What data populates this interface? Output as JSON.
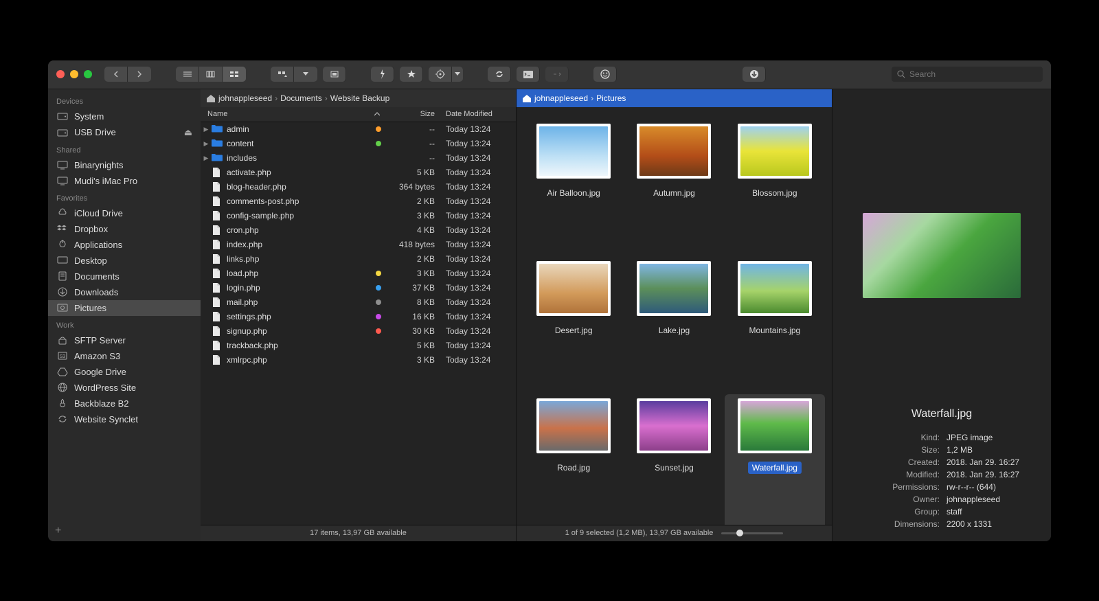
{
  "search_placeholder": "Search",
  "sidebar": {
    "sections": [
      {
        "title": "Devices",
        "items": [
          {
            "icon": "drive",
            "label": "System"
          },
          {
            "icon": "drive",
            "label": "USB Drive",
            "eject": true
          }
        ]
      },
      {
        "title": "Shared",
        "items": [
          {
            "icon": "monitor",
            "label": "Binarynights"
          },
          {
            "icon": "monitor",
            "label": "Mudi's iMac Pro"
          }
        ]
      },
      {
        "title": "Favorites",
        "items": [
          {
            "icon": "cloud",
            "label": "iCloud Drive"
          },
          {
            "icon": "dropbox",
            "label": "Dropbox"
          },
          {
            "icon": "apps",
            "label": "Applications"
          },
          {
            "icon": "desktop",
            "label": "Desktop"
          },
          {
            "icon": "doc",
            "label": "Documents"
          },
          {
            "icon": "download",
            "label": "Downloads"
          },
          {
            "icon": "pictures",
            "label": "Pictures",
            "selected": true
          }
        ]
      },
      {
        "title": "Work",
        "items": [
          {
            "icon": "lock",
            "label": "SFTP Server"
          },
          {
            "icon": "s3",
            "label": "Amazon S3"
          },
          {
            "icon": "gdrive",
            "label": "Google Drive"
          },
          {
            "icon": "globe",
            "label": "WordPress Site"
          },
          {
            "icon": "flame",
            "label": "Backblaze B2"
          },
          {
            "icon": "sync",
            "label": "Website Synclet"
          }
        ]
      }
    ]
  },
  "left_pane": {
    "breadcrumb": [
      "johnappleseed",
      "Documents",
      "Website Backup"
    ],
    "columns": {
      "name": "Name",
      "size": "Size",
      "date": "Date Modified"
    },
    "rows": [
      {
        "type": "folder",
        "name": "admin",
        "size": "--",
        "date": "Today 13:24",
        "tag": "#ff9e2c",
        "expandable": true
      },
      {
        "type": "folder",
        "name": "content",
        "size": "--",
        "date": "Today 13:24",
        "tag": "#63d04a",
        "expandable": true
      },
      {
        "type": "folder",
        "name": "includes",
        "size": "--",
        "date": "Today 13:24",
        "expandable": true
      },
      {
        "type": "file",
        "name": "activate.php",
        "size": "5 KB",
        "date": "Today 13:24"
      },
      {
        "type": "file",
        "name": "blog-header.php",
        "size": "364 bytes",
        "date": "Today 13:24"
      },
      {
        "type": "file",
        "name": "comments-post.php",
        "size": "2 KB",
        "date": "Today 13:24"
      },
      {
        "type": "file",
        "name": "config-sample.php",
        "size": "3 KB",
        "date": "Today 13:24"
      },
      {
        "type": "file",
        "name": "cron.php",
        "size": "4 KB",
        "date": "Today 13:24"
      },
      {
        "type": "file",
        "name": "index.php",
        "size": "418 bytes",
        "date": "Today 13:24"
      },
      {
        "type": "file",
        "name": "links.php",
        "size": "2 KB",
        "date": "Today 13:24"
      },
      {
        "type": "file",
        "name": "load.php",
        "size": "3 KB",
        "date": "Today 13:24",
        "tag": "#f4d742"
      },
      {
        "type": "file",
        "name": "login.php",
        "size": "37 KB",
        "date": "Today 13:24",
        "tag": "#38a0f0"
      },
      {
        "type": "file",
        "name": "mail.php",
        "size": "8 KB",
        "date": "Today 13:24",
        "tag": "#8e8e8e"
      },
      {
        "type": "file",
        "name": "settings.php",
        "size": "16 KB",
        "date": "Today 13:24",
        "tag": "#c84ae8"
      },
      {
        "type": "file",
        "name": "signup.php",
        "size": "30 KB",
        "date": "Today 13:24",
        "tag": "#ff5a4f"
      },
      {
        "type": "file",
        "name": "trackback.php",
        "size": "5 KB",
        "date": "Today 13:24"
      },
      {
        "type": "file",
        "name": "xmlrpc.php",
        "size": "3 KB",
        "date": "Today 13:24"
      }
    ],
    "status": "17 items, 13,97 GB available"
  },
  "right_pane": {
    "breadcrumb": [
      "johnappleseed",
      "Pictures"
    ],
    "items": [
      {
        "name": "Air Balloon.jpg",
        "gradient": "linear-gradient(180deg,#6db3e8 0%,#bde0f5 60%,#eef6fb 100%)"
      },
      {
        "name": "Autumn.jpg",
        "gradient": "linear-gradient(180deg,#d88b2a 0%,#b34d18 60%,#6e3a17 100%)"
      },
      {
        "name": "Blossom.jpg",
        "gradient": "linear-gradient(180deg,#9ed1f0 0%,#e9e439 50%,#b9c81e 100%)"
      },
      {
        "name": "Desert.jpg",
        "gradient": "linear-gradient(180deg,#e9d7bc 0%,#d29a5a 60%,#b0733a 100%)"
      },
      {
        "name": "Lake.jpg",
        "gradient": "linear-gradient(180deg,#7fb6e3 0%,#5c8f5a 50%,#2e5a7a 100%)"
      },
      {
        "name": "Mountains.jpg",
        "gradient": "linear-gradient(180deg,#6fb4e6 0%,#a6d36a 55%,#4a8a2e 100%)"
      },
      {
        "name": "Road.jpg",
        "gradient": "linear-gradient(180deg,#7aa7d8 0%,#c9724a 55%,#6a6a6a 100%)"
      },
      {
        "name": "Sunset.jpg",
        "gradient": "linear-gradient(180deg,#5a3d9e 0%,#d96fcf 50%,#8c3f8a 100%)"
      },
      {
        "name": "Waterfall.jpg",
        "gradient": "linear-gradient(180deg,#d6a6d8 0%,#5fba4a 45%,#2a7a3a 100%)",
        "selected": true
      }
    ],
    "status": "1 of 9 selected (1,2 MB), 13,97 GB available"
  },
  "preview": {
    "name": "Waterfall.jpg",
    "gradient": "linear-gradient(135deg,#d6a6d8 0%,#a6d8a0 30%,#4aa63f 55%,#2a6a3a 100%)",
    "meta": [
      {
        "label": "Kind:",
        "value": "JPEG image"
      },
      {
        "label": "Size:",
        "value": "1,2 MB"
      },
      {
        "label": "Created:",
        "value": "2018. Jan 29. 16:27"
      },
      {
        "label": "Modified:",
        "value": "2018. Jan 29. 16:27"
      },
      {
        "label": "Permissions:",
        "value": "rw-r--r-- (644)"
      },
      {
        "label": "Owner:",
        "value": "johnappleseed"
      },
      {
        "label": "Group:",
        "value": "staff"
      },
      {
        "label": "Dimensions:",
        "value": "2200 x 1331"
      }
    ]
  }
}
